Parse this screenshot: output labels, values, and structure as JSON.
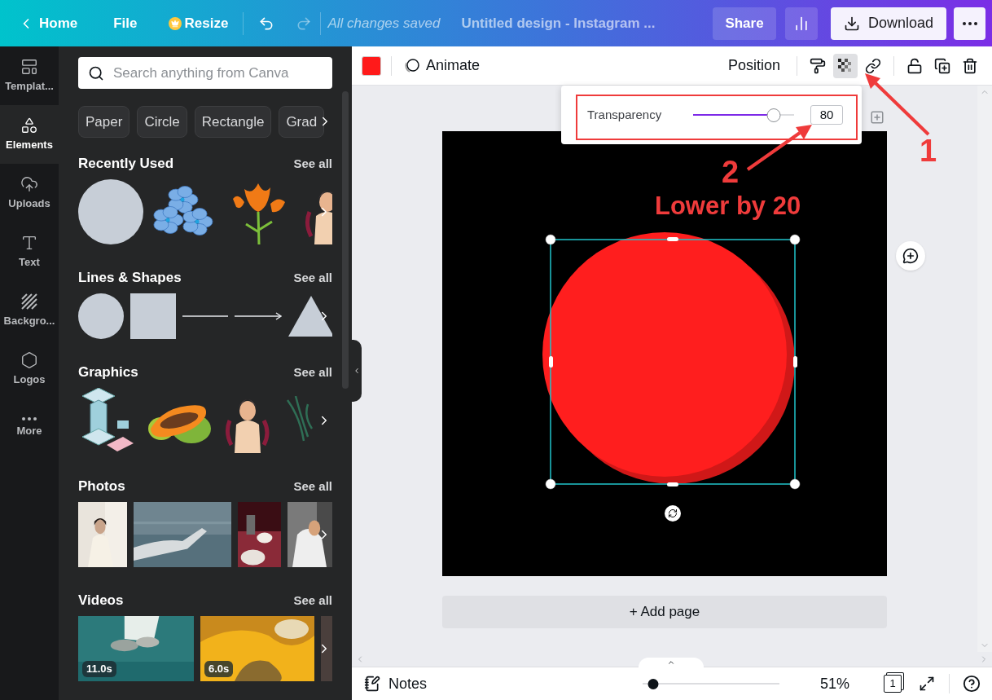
{
  "top_bar": {
    "home": "Home",
    "file": "File",
    "resize": "Resize",
    "status": "All changes saved",
    "title": "Untitled design - Instagram ...",
    "share": "Share",
    "download": "Download"
  },
  "rail": [
    {
      "label": "Templat...",
      "kind": "templates",
      "selected": false
    },
    {
      "label": "Elements",
      "kind": "elements",
      "selected": true
    },
    {
      "label": "Uploads",
      "kind": "uploads",
      "selected": false
    },
    {
      "label": "Text",
      "kind": "text",
      "selected": false
    },
    {
      "label": "Backgro...",
      "kind": "backgrounds",
      "selected": false
    },
    {
      "label": "Logos",
      "kind": "logos",
      "selected": false
    },
    {
      "label": "More",
      "kind": "more",
      "selected": false
    }
  ],
  "panel": {
    "search": {
      "placeholder": "Search anything from Canva"
    },
    "chips": [
      "Paper",
      "Circle",
      "Rectangle",
      "Grad"
    ],
    "sections": [
      {
        "title": "Recently Used",
        "see_all": "See all",
        "kind": "recent"
      },
      {
        "title": "Lines & Shapes",
        "see_all": "See all",
        "kind": "shapes"
      },
      {
        "title": "Graphics",
        "see_all": "See all",
        "kind": "graphics"
      },
      {
        "title": "Photos",
        "see_all": "See all",
        "kind": "photos"
      },
      {
        "title": "Videos",
        "see_all": "See all",
        "kind": "videos",
        "durations": [
          "11.0s",
          "6.0s"
        ]
      }
    ]
  },
  "toolbar": {
    "animate": "Animate",
    "position": "Position",
    "tools": [
      {
        "kind": "paint",
        "selected": false
      },
      {
        "kind": "transparency",
        "selected": true
      },
      {
        "kind": "link",
        "selected": false
      }
    ]
  },
  "transparency": {
    "label": "Transparency",
    "level": 0.8,
    "value": "80"
  },
  "annotations": {
    "label_1": "1",
    "label_2": "2",
    "note": "Lower by 20"
  },
  "canvas": {
    "add_page": "+ Add page"
  },
  "bottom_bar": {
    "notes": "Notes",
    "zoom": {
      "level": 0.08
    },
    "zoom_value": "51%",
    "page_count": "1"
  }
}
